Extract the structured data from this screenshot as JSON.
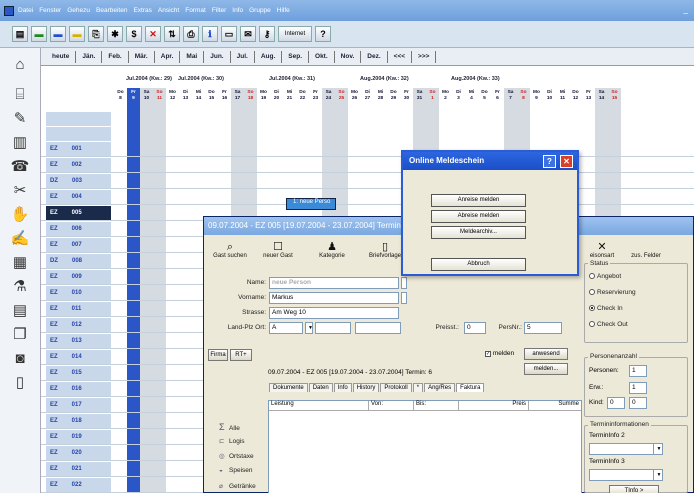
{
  "menubar": {
    "items": [
      "Datei",
      "Fenster",
      "Gehezu",
      "Bearbeiten",
      "Extras",
      "Ansicht",
      "Format",
      "Filter",
      "Info",
      "Gruppe",
      "Hilfe"
    ],
    "minimize": "_"
  },
  "toolbar": {
    "internet_label": "Internet"
  },
  "month_tabs": [
    "heute",
    "Jän.",
    "Feb.",
    "Mär.",
    "Apr.",
    "Mai",
    "Jun.",
    "Jul.",
    "Aug.",
    "Sep.",
    "Okt.",
    "Nov.",
    "Dez.",
    "<<<",
    ">>>"
  ],
  "weeks": [
    "Jul.2004 (Kw.: 29)",
    "Jul.2004 (Kw.: 30)",
    "Jul.2004 (Kw.: 31)",
    "Aug.2004 (Kw.: 32)",
    "Aug.2004 (Kw.: 33)"
  ],
  "day_columns": [
    {
      "d": "Do",
      "n": "8"
    },
    {
      "d": "Fr",
      "n": "9"
    },
    {
      "d": "Sa",
      "n": "10"
    },
    {
      "d": "So",
      "n": "11"
    },
    {
      "d": "Mo",
      "n": "12"
    },
    {
      "d": "Di",
      "n": "13"
    },
    {
      "d": "Mi",
      "n": "14"
    },
    {
      "d": "Do",
      "n": "15"
    },
    {
      "d": "Fr",
      "n": "16"
    },
    {
      "d": "Sa",
      "n": "17"
    },
    {
      "d": "So",
      "n": "18"
    },
    {
      "d": "Mo",
      "n": "19"
    },
    {
      "d": "Di",
      "n": "20"
    },
    {
      "d": "Mi",
      "n": "21"
    },
    {
      "d": "Do",
      "n": "22"
    },
    {
      "d": "Fr",
      "n": "23"
    },
    {
      "d": "Sa",
      "n": "24"
    },
    {
      "d": "So",
      "n": "25"
    },
    {
      "d": "Mo",
      "n": "26"
    },
    {
      "d": "Di",
      "n": "27"
    },
    {
      "d": "Mi",
      "n": "28"
    },
    {
      "d": "Do",
      "n": "29"
    },
    {
      "d": "Fr",
      "n": "30"
    },
    {
      "d": "Sa",
      "n": "31"
    },
    {
      "d": "So",
      "n": "1"
    },
    {
      "d": "Mo",
      "n": "2"
    },
    {
      "d": "Di",
      "n": "3"
    },
    {
      "d": "Mi",
      "n": "4"
    },
    {
      "d": "Do",
      "n": "5"
    },
    {
      "d": "Fr",
      "n": "6"
    },
    {
      "d": "Sa",
      "n": "7"
    },
    {
      "d": "So",
      "n": "8"
    },
    {
      "d": "Mo",
      "n": "9"
    },
    {
      "d": "Di",
      "n": "10"
    },
    {
      "d": "Mi",
      "n": "11"
    },
    {
      "d": "Do",
      "n": "12"
    },
    {
      "d": "Fr",
      "n": "13"
    },
    {
      "d": "Sa",
      "n": "14"
    },
    {
      "d": "So",
      "n": "15"
    }
  ],
  "rooms": [
    {
      "type": "EZ",
      "num": "001"
    },
    {
      "type": "EZ",
      "num": "002"
    },
    {
      "type": "DZ",
      "num": "003"
    },
    {
      "type": "EZ",
      "num": "004"
    },
    {
      "type": "EZ",
      "num": "005",
      "selected": true
    },
    {
      "type": "EZ",
      "num": "006"
    },
    {
      "type": "EZ",
      "num": "007"
    },
    {
      "type": "DZ",
      "num": "008"
    },
    {
      "type": "EZ",
      "num": "009"
    },
    {
      "type": "EZ",
      "num": "010"
    },
    {
      "type": "EZ",
      "num": "011"
    },
    {
      "type": "EZ",
      "num": "012"
    },
    {
      "type": "EZ",
      "num": "013"
    },
    {
      "type": "EZ",
      "num": "014"
    },
    {
      "type": "EZ",
      "num": "015"
    },
    {
      "type": "EZ",
      "num": "016"
    },
    {
      "type": "EZ",
      "num": "017"
    },
    {
      "type": "EZ",
      "num": "018"
    },
    {
      "type": "EZ",
      "num": "019"
    },
    {
      "type": "EZ",
      "num": "020"
    },
    {
      "type": "EZ",
      "num": "021"
    },
    {
      "type": "EZ",
      "num": "022"
    },
    {
      "type": "EZ",
      "num": "023"
    }
  ],
  "booking_bar": {
    "label": "1: neue Perso"
  },
  "dialog": {
    "title": "09.07.2004 - EZ  005 [19.07.2004 - 23.07.2004] Termin",
    "buttons": [
      "Gast suchen",
      "neuer Gast",
      "Kategorie",
      "Briefvorlage"
    ],
    "right_buttons": [
      "eisonsart",
      "zus. Felder"
    ],
    "name_label": "Name:",
    "name_value": "neue Person",
    "vorname_label": "Vorname:",
    "vorname_value": "Markus",
    "strasse_label": "Strasse:",
    "strasse_value": "Am Weg 10",
    "land_label": "Land-Plz Ort:",
    "land_value": "A",
    "preisst_label": "Preisst.:",
    "preisst_value": "0",
    "persnr_label": "PersNr.:",
    "persnr_value": "5",
    "firma_label": "Firma",
    "rt_label": "RT+",
    "melden_label": "melden",
    "anwesend_label": "anwesend",
    "melden_button": "melden...",
    "info_line": "09.07.2004 - EZ  005 [19.07.2004 - 23.07.2004] Termin: 6",
    "tabs": [
      "Dokumente",
      "Daten",
      "Info",
      "History",
      "Protokoll",
      "*",
      "Ang/Res",
      "Faktura"
    ],
    "table_headers": [
      "Leistung",
      "Von:",
      "Bis:",
      "Preis",
      "Summe"
    ],
    "side_links": [
      {
        "icon": "sum-icon",
        "label": "Alle"
      },
      {
        "icon": "bed-icon",
        "label": "Logis"
      },
      {
        "icon": "coin-icon",
        "label": "Ortstaxe"
      },
      {
        "icon": "plate-icon",
        "label": "Speisen"
      },
      {
        "icon": "glass-icon",
        "label": "Getränke"
      }
    ],
    "status_title": "Status",
    "status_options": [
      {
        "label": "Angebot",
        "checked": false
      },
      {
        "label": "Reservierung",
        "checked": false
      },
      {
        "label": "Check In",
        "checked": true
      },
      {
        "label": "Check Out",
        "checked": false
      }
    ],
    "personen_title": "Personenanzahl",
    "personen": [
      {
        "label": "Personen:",
        "value": "1"
      },
      {
        "label": "Erw.:",
        "value": "1"
      },
      {
        "label": "Kind:",
        "value": "0",
        "extra": "0"
      }
    ],
    "termin_title": "Termininformationen",
    "termin_info2": "TerminInfo 2",
    "termin_info3": "TerminInfo 3",
    "tinfo_button": "TInfo >"
  },
  "meldeschein": {
    "title": "Online Meldeschein",
    "help": "?",
    "close": "✕",
    "buttons": [
      "Anreise melden",
      "Abreise melden",
      "Meldearchiv..."
    ],
    "cancel": "Abbruch"
  }
}
